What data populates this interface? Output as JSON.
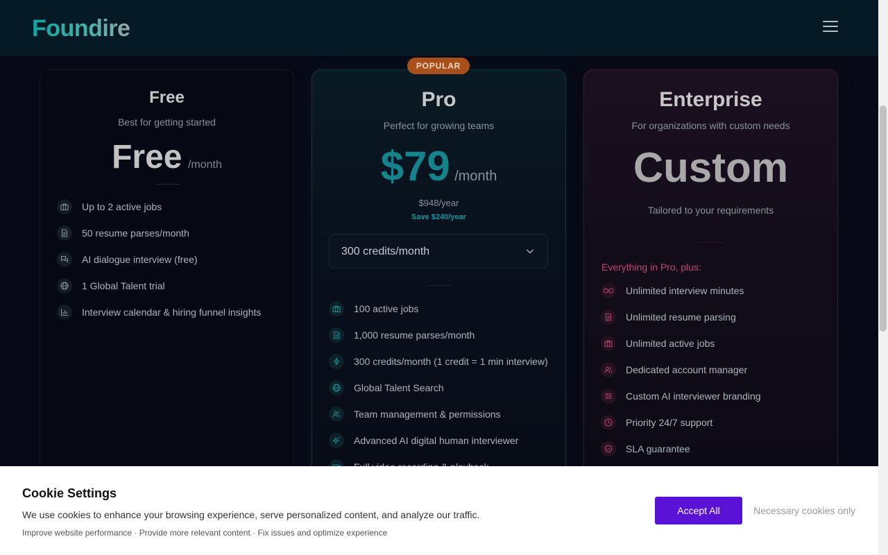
{
  "header": {
    "logo": "Foundire",
    "menu_icon": "hamburger-menu-icon"
  },
  "plans": {
    "free": {
      "name": "Free",
      "tagline": "Best for getting started",
      "price": "Free",
      "period": "/month",
      "features": [
        {
          "icon": "briefcase-icon",
          "label": "Up to 2 active jobs"
        },
        {
          "icon": "document-icon",
          "label": "50 resume parses/month"
        },
        {
          "icon": "chat-icon",
          "label": "AI dialogue interview (free)"
        },
        {
          "icon": "globe-icon",
          "label": "1 Global Talent trial"
        },
        {
          "icon": "bar-chart-icon",
          "label": "Interview calendar & hiring funnel insights"
        }
      ]
    },
    "pro": {
      "badge": "POPULAR",
      "name": "Pro",
      "tagline": "Perfect for growing teams",
      "price": "$79",
      "period": "/month",
      "yearly": "$948/year",
      "save": "Save $240/year",
      "credits_select": "300 credits/month",
      "features": [
        {
          "icon": "briefcase-icon",
          "label": "100 active jobs"
        },
        {
          "icon": "document-icon",
          "label": "1,000 resume parses/month"
        },
        {
          "icon": "lightning-icon",
          "label": "300 credits/month (1 credit = 1 min interview)"
        },
        {
          "icon": "globe-icon",
          "label": "Global Talent Search"
        },
        {
          "icon": "users-icon",
          "label": "Team management & permissions"
        },
        {
          "icon": "sparkle-icon",
          "label": "Advanced AI digital human interviewer"
        },
        {
          "icon": "video-icon",
          "label": "Full video recording & playback"
        }
      ]
    },
    "enterprise": {
      "name": "Enterprise",
      "tagline": "For organizations with custom needs",
      "price": "Custom",
      "note": "Tailored to your requirements",
      "plus": "Everything in Pro, plus:",
      "features": [
        {
          "icon": "infinity-icon",
          "label": "Unlimited interview minutes"
        },
        {
          "icon": "document-icon",
          "label": "Unlimited resume parsing"
        },
        {
          "icon": "briefcase-icon",
          "label": "Unlimited active jobs"
        },
        {
          "icon": "users-icon",
          "label": "Dedicated account manager"
        },
        {
          "icon": "sliders-icon",
          "label": "Custom AI interviewer branding"
        },
        {
          "icon": "clock-icon",
          "label": "Priority 24/7 support"
        },
        {
          "icon": "shield-icon",
          "label": "SLA guarantee"
        }
      ]
    }
  },
  "cookie": {
    "title": "Cookie Settings",
    "message": "We use cookies to enhance your browsing experience, serve personalized content, and analyze our traffic.",
    "details": "Improve website performance · Provide more relevant content · Fix issues and optimize experience",
    "accept": "Accept All",
    "necessary": "Necessary cookies only"
  },
  "colors": {
    "pro_accent": "#14838c",
    "enterprise_accent": "#c0457d",
    "accept_button": "#5a12d6",
    "badge": "#a8501c"
  }
}
